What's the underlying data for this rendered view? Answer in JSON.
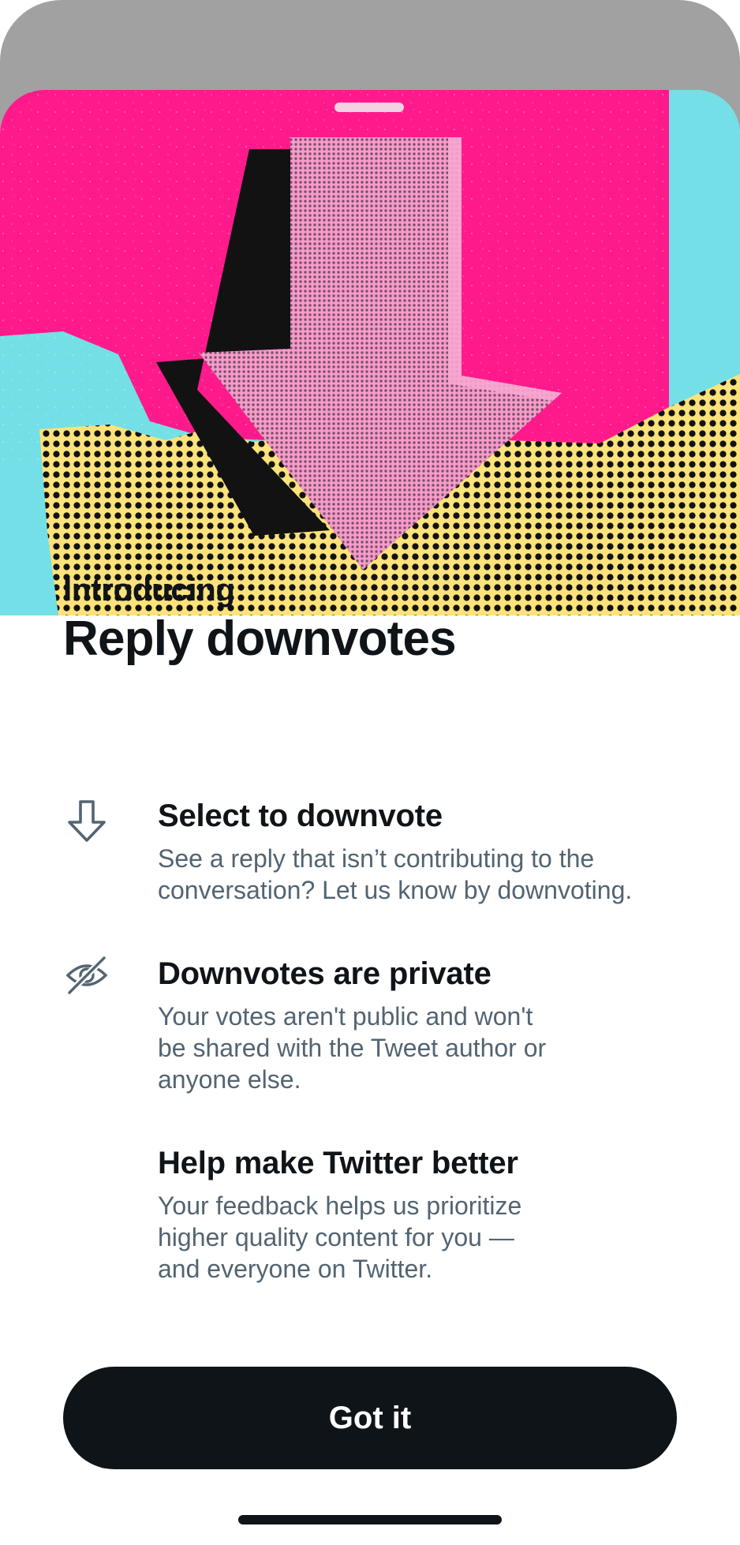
{
  "colors": {
    "backdrop": "#a1a1a2",
    "hero_pink": "#ff1a8c",
    "hero_cyan": "#74dfe6",
    "hero_yellow": "#fbe27a",
    "arrow_pink": "#f79bcb",
    "text_primary": "#0f1419",
    "text_secondary": "#536471",
    "button_bg": "#0f1419",
    "button_text": "#ffffff"
  },
  "hero": {
    "illustration": "down-arrow-collage-illustration"
  },
  "header": {
    "intro": "Introducing",
    "title": "Reply downvotes"
  },
  "features": [
    {
      "icon": "arrow-down-icon",
      "title": "Select to downvote",
      "description": "See a reply that isn’t contributing to the\nconversation? Let us know by downvoting."
    },
    {
      "icon": "eye-slash-icon",
      "title": "Downvotes are private",
      "description": "Your votes aren't public and won't\nbe shared with the Tweet author or\nanyone else."
    },
    {
      "icon": "",
      "title": "Help make Twitter better",
      "description": "Your feedback helps us prioritize\nhigher quality content for you —\nand everyone on Twitter."
    }
  ],
  "actions": {
    "primary_label": "Got it"
  }
}
